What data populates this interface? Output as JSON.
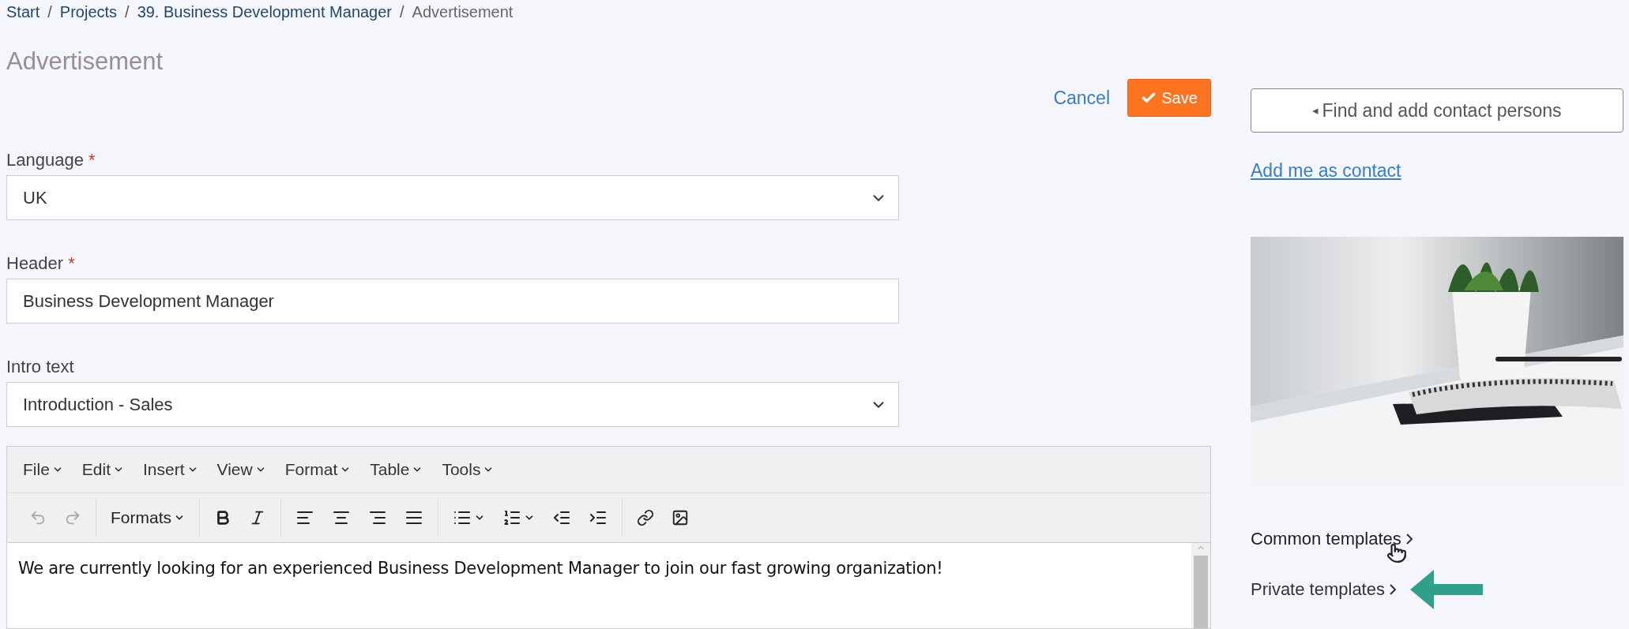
{
  "breadcrumb": [
    {
      "label": "Start",
      "current": false
    },
    {
      "separator": "/",
      "label": "Projects",
      "current": false
    },
    {
      "separator": "/",
      "label": "39. Business Development Manager",
      "current": false
    },
    {
      "separator": "/",
      "label": "Advertisement",
      "current": true
    }
  ],
  "page_title": "Advertisement",
  "actions": {
    "cancel": "Cancel",
    "save": "Save"
  },
  "fields": [
    {
      "kind": "select",
      "label": "Language",
      "required_mark": "*",
      "value": "UK"
    },
    {
      "kind": "text",
      "label": "Header",
      "required_mark": "*",
      "value": "Business Development Manager"
    },
    {
      "kind": "select",
      "label": "Intro text",
      "value": "Introduction - Sales"
    }
  ],
  "editor": {
    "menus": [
      "File",
      "Edit",
      "Insert",
      "View",
      "Format",
      "Table",
      "Tools"
    ],
    "undo": {
      "disabled": true
    },
    "redo": {
      "disabled": true
    },
    "formats": "Formats",
    "content": "We are currently looking for an experienced Business Development Manager to join our fast growing organization!"
  },
  "sidebar": {
    "find_button": {
      "icon": "◂",
      "label": "Find and add contact persons"
    },
    "add_me_link": "Add me as contact",
    "templates": [
      {
        "label": "Common templates",
        "hovered": true,
        "pointed": false
      },
      {
        "label": "Private templates",
        "hovered": false,
        "pointed": true
      }
    ]
  }
}
